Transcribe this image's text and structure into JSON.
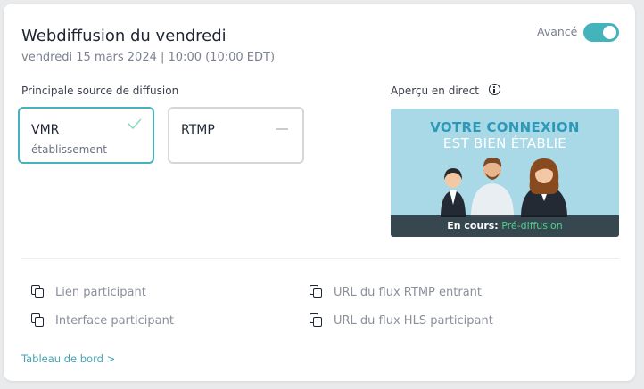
{
  "header": {
    "title": "Webdiffusion du vendredi",
    "subtitle": "vendredi 15 mars 2024 | 10:00 (10:00 EDT)",
    "advanced_label": "Avancé",
    "advanced_enabled": true
  },
  "source": {
    "section_label": "Principale source de diffusion",
    "options": [
      {
        "name": "VMR",
        "sub": "établissement",
        "selected": true
      },
      {
        "name": "RTMP",
        "sub": "",
        "selected": false
      }
    ]
  },
  "preview": {
    "label": "Aperçu en direct",
    "line1": "VOTRE CONNEXION",
    "line2": "EST BIEN ÉTABLIE",
    "status_label": "En cours:",
    "status_value": "Pré-diffusion"
  },
  "links": [
    {
      "label": "Lien participant",
      "icon": "copy-icon"
    },
    {
      "label": "Interface participant",
      "icon": "copy-icon"
    },
    {
      "label": "URL du flux RTMP entrant",
      "icon": "copy-icon"
    },
    {
      "label": "URL du flux HLS participant",
      "icon": "copy-icon"
    }
  ],
  "dashboard_link": "Tableau de bord >",
  "colors": {
    "accent": "#45b3bc",
    "status_green": "#4fd08a",
    "preview_bg": "#a9d9e6"
  }
}
